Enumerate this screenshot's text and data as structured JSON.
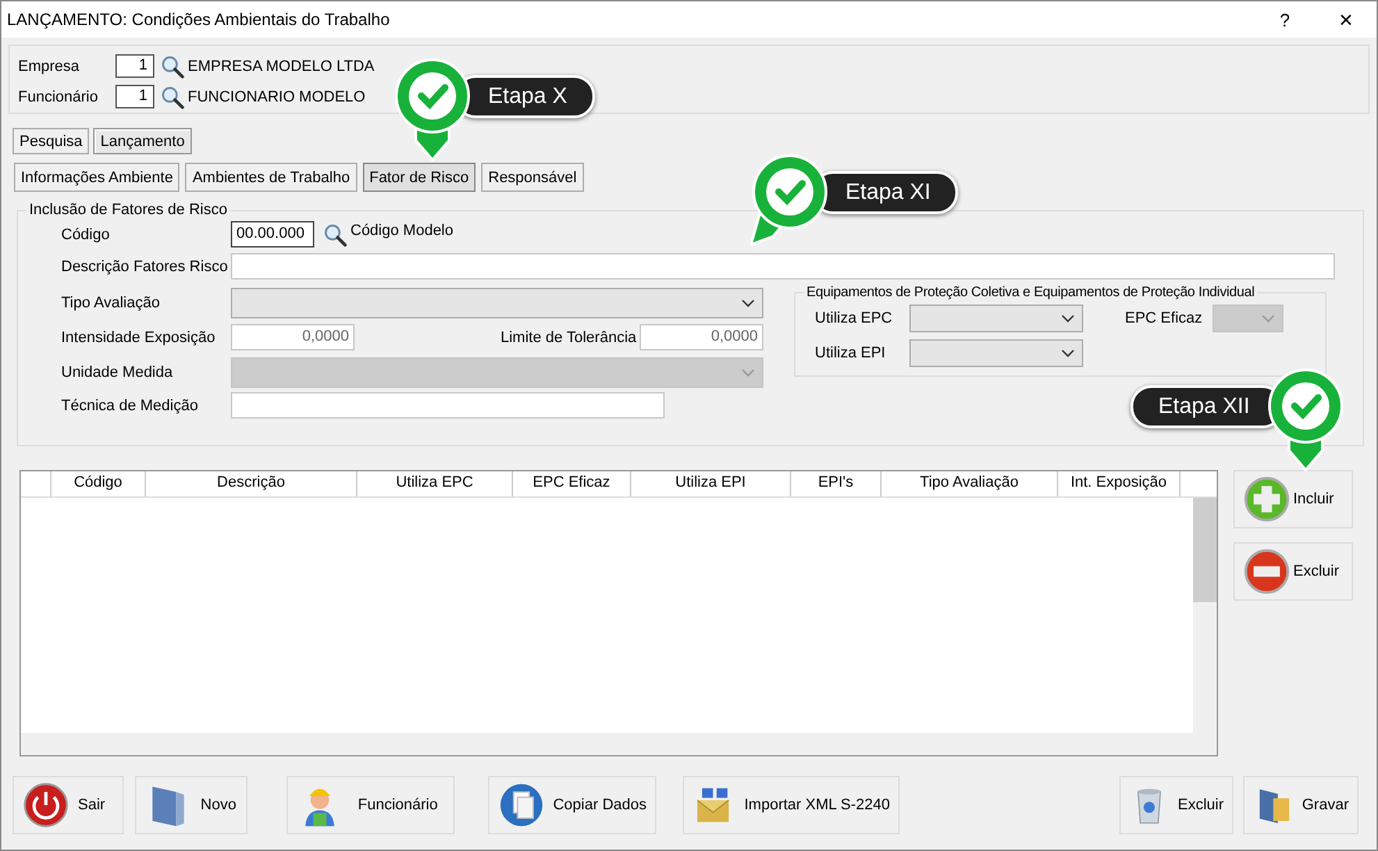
{
  "window": {
    "title": "LANÇAMENTO: Condições Ambientais do Trabalho",
    "help": "?",
    "close": "✕"
  },
  "header": [
    {
      "label": "Empresa",
      "code": "1",
      "name": "EMPRESA MODELO LTDA"
    },
    {
      "label": "Funcionário",
      "code": "1",
      "name": "FUNCIONARIO MODELO"
    }
  ],
  "tabs": [
    {
      "label": "Pesquisa",
      "selected": false
    },
    {
      "label": "Lançamento",
      "selected": true
    }
  ],
  "subtabs": [
    {
      "label": "Informações Ambiente",
      "selected": false
    },
    {
      "label": "Ambientes de Trabalho",
      "selected": false
    },
    {
      "label": "Fator de Risco",
      "selected": true
    },
    {
      "label": "Responsável",
      "selected": false
    }
  ],
  "risk_group": {
    "title": "Inclusão de Fatores de Risco",
    "codigo": {
      "label": "Código",
      "value": "00.00.000",
      "lookup": "Código Modelo"
    },
    "descricao": {
      "label": "Descrição Fatores Risco"
    },
    "tipo_avaliacao": {
      "label": "Tipo Avaliação",
      "disabled": false
    },
    "intensidade": {
      "label": "Intensidade Exposição",
      "value": "0,0000"
    },
    "limite": {
      "label": "Limite de Tolerância",
      "value": "0,0000"
    },
    "unidade": {
      "label": "Unidade Medida",
      "disabled": true
    },
    "tecnica": {
      "label": "Técnica de Medição"
    },
    "equipment_group": {
      "title": "Equipamentos de Proteção Coletiva e Equipamentos de Proteção Individual",
      "utiliza_epc": {
        "label": "Utiliza EPC",
        "disabled": false
      },
      "utiliza_epi": {
        "label": "Utiliza EPI",
        "disabled": false
      },
      "epc_eficaz": {
        "label": "EPC Eficaz",
        "disabled": true
      }
    }
  },
  "table": {
    "columns": [
      "Código",
      "Descrição",
      "Utiliza EPC",
      "EPC Eficaz",
      "Utiliza EPI",
      "EPI's",
      "Tipo Avaliação",
      "Int. Exposição"
    ]
  },
  "side_buttons": [
    {
      "label": "Incluir",
      "kind": "add"
    },
    {
      "label": "Excluir",
      "kind": "remove"
    }
  ],
  "toolbar": [
    {
      "label": "Sair",
      "kind": "power"
    },
    {
      "label": "Novo",
      "kind": "folder"
    },
    {
      "label": "Funcionário",
      "kind": "worker"
    },
    {
      "label": "Copiar Dados",
      "kind": "copy"
    },
    {
      "label": "Importar XML S-2240",
      "kind": "import"
    },
    {
      "label": "Excluir",
      "kind": "trash"
    },
    {
      "label": "Gravar",
      "kind": "save"
    }
  ],
  "callouts": [
    {
      "label": "Etapa X",
      "kind": "right"
    },
    {
      "label": "Etapa XI",
      "kind": "right"
    },
    {
      "label": "Etapa XII",
      "kind": "left"
    }
  ]
}
